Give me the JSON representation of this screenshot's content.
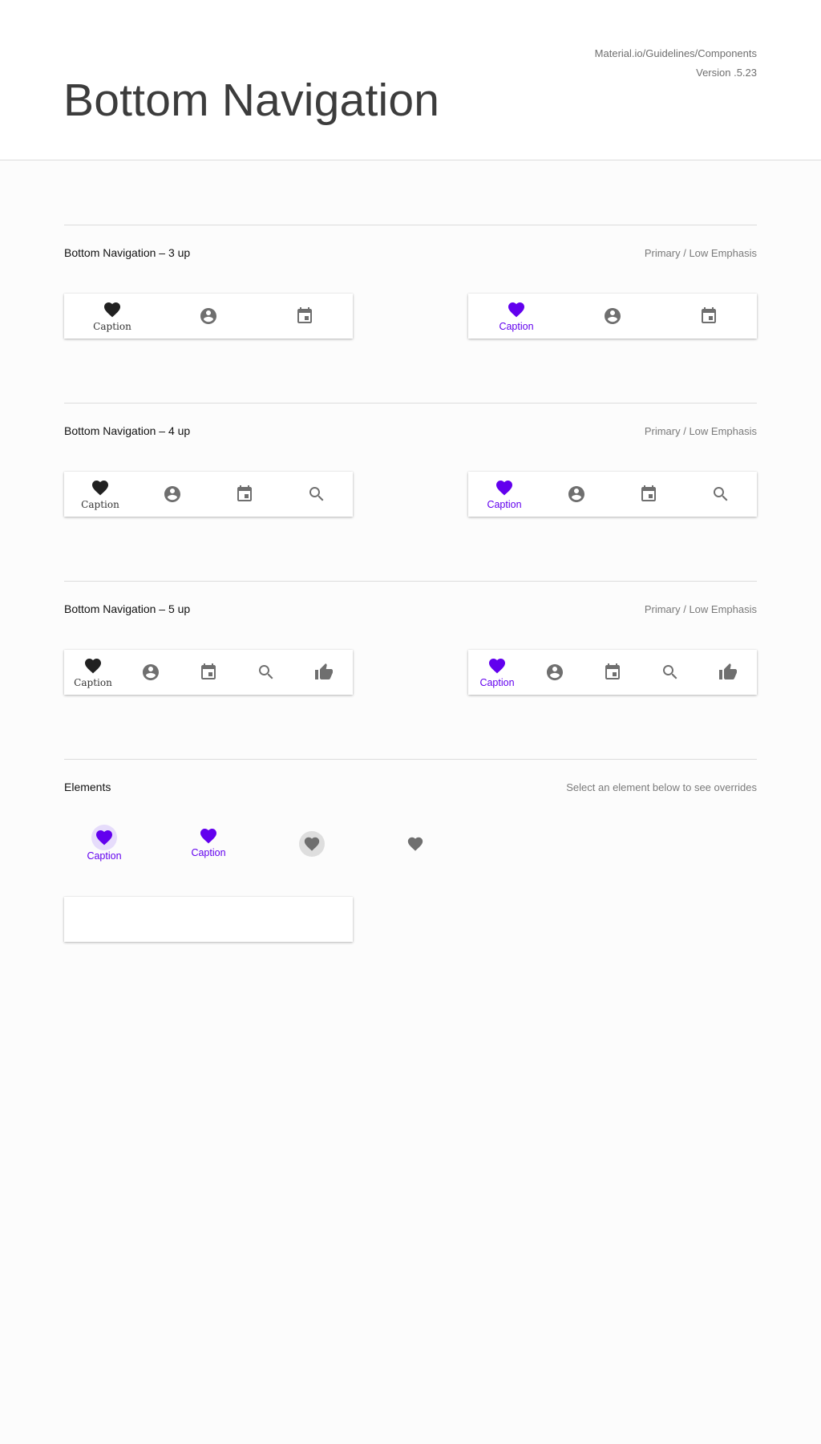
{
  "page": {
    "title": "Bottom Navigation",
    "meta_line1": "Material.io/Guidelines/Components",
    "meta_line2": "Version .5.23"
  },
  "colors": {
    "primary": "#6200ee",
    "icon_inactive": "#6f6f6f",
    "icon_dark": "#212121",
    "ripple_primary": "#e6dcfb",
    "ripple_gray": "#dedede"
  },
  "sections": [
    {
      "title": "Bottom Navigation – 3 up",
      "subtitle": "Primary / Low Emphasis",
      "low_bar": {
        "items": [
          "heart-icon",
          "account-circle-icon",
          "calendar-icon"
        ],
        "active_caption": "Caption"
      },
      "primary_bar": {
        "items": [
          "heart-icon",
          "account-circle-icon",
          "calendar-icon"
        ],
        "active_caption": "Caption"
      }
    },
    {
      "title": "Bottom Navigation – 4 up",
      "subtitle": "Primary / Low Emphasis",
      "low_bar": {
        "items": [
          "heart-icon",
          "account-circle-icon",
          "calendar-icon",
          "search-icon"
        ],
        "active_caption": "Caption"
      },
      "primary_bar": {
        "items": [
          "heart-icon",
          "account-circle-icon",
          "calendar-icon",
          "search-icon"
        ],
        "active_caption": "Caption"
      }
    },
    {
      "title": "Bottom Navigation – 5 up",
      "subtitle": "Primary / Low Emphasis",
      "low_bar": {
        "items": [
          "heart-icon",
          "account-circle-icon",
          "calendar-icon",
          "search-icon",
          "thumb-up-icon"
        ],
        "active_caption": "Caption"
      },
      "primary_bar": {
        "items": [
          "heart-icon",
          "account-circle-icon",
          "calendar-icon",
          "search-icon",
          "thumb-up-icon"
        ],
        "active_caption": "Caption"
      }
    }
  ],
  "elements": {
    "title": "Elements",
    "subtitle": "Select an element below to see overrides",
    "items": [
      {
        "caption": "Caption",
        "state": "active-focused"
      },
      {
        "caption": "Caption",
        "state": "active"
      },
      {
        "caption": "",
        "state": "inactive-focused"
      },
      {
        "caption": "",
        "state": "inactive"
      }
    ]
  }
}
